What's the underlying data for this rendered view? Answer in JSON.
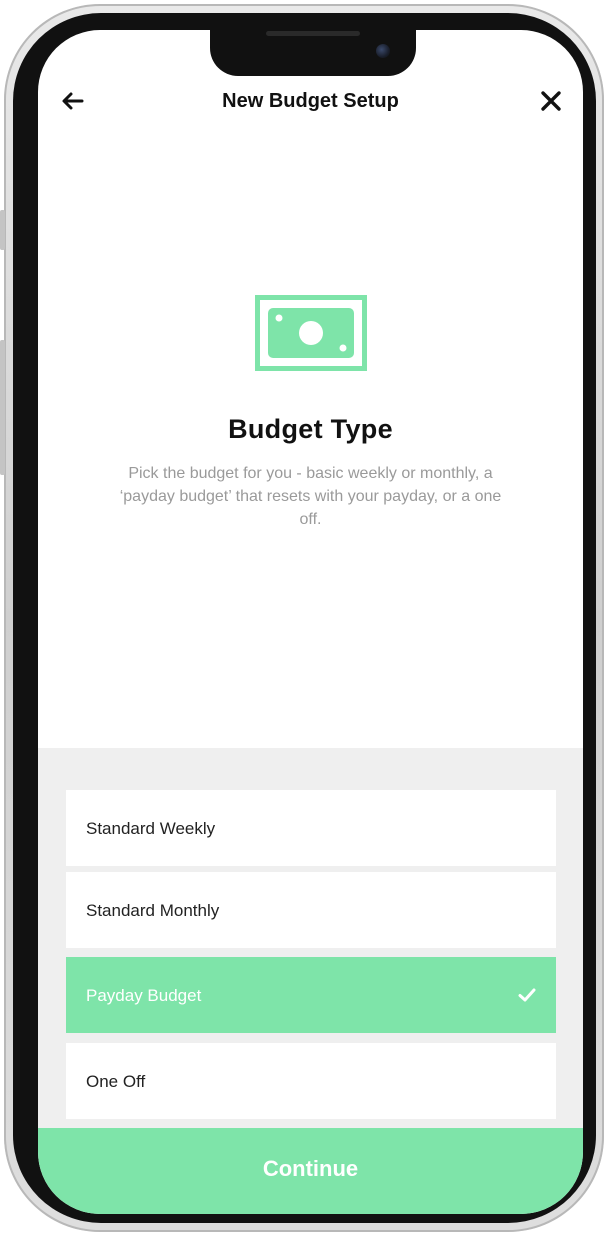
{
  "nav": {
    "back_icon": "arrow-left-icon",
    "title": "New Budget Setup",
    "close_icon": "close-icon"
  },
  "header": {
    "icon": "banknote-icon",
    "heading": "Budget Type",
    "description": "Pick the budget for you - basic weekly or monthly, a ‘payday budget’ that resets with your payday, or a one off."
  },
  "options": [
    {
      "label": "Standard Weekly",
      "selected": false
    },
    {
      "label": "Standard Monthly",
      "selected": false
    },
    {
      "label": "Payday Budget",
      "selected": true
    },
    {
      "label": "One Off",
      "selected": false
    }
  ],
  "continue_label": "Continue",
  "colors": {
    "accent": "#7ee4a9",
    "background_area": "#efefef",
    "text_primary": "#111111",
    "text_secondary": "#9a9a9a"
  }
}
